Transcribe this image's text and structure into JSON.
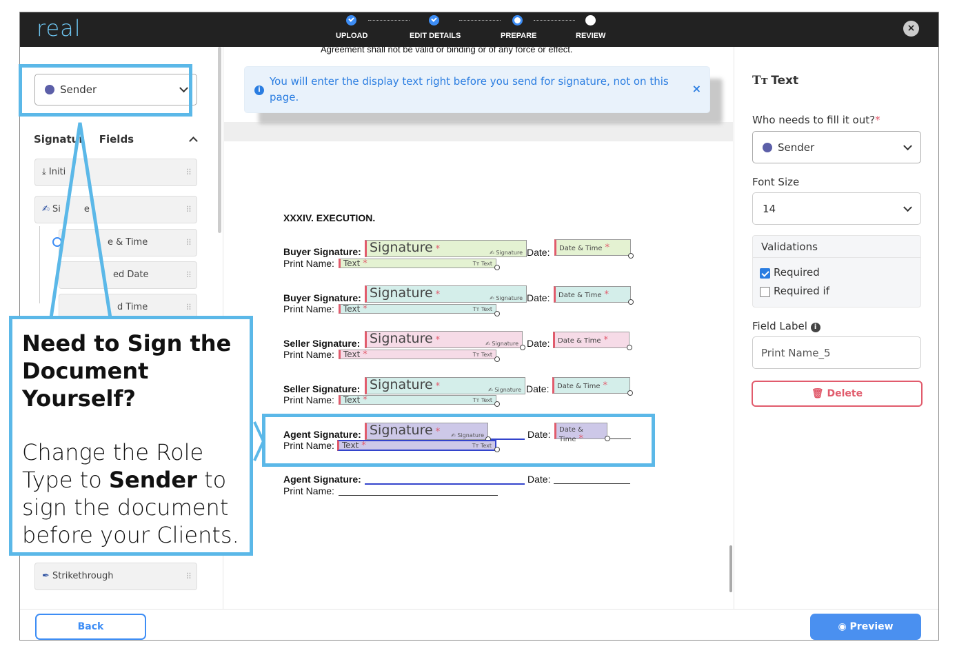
{
  "header": {
    "logo": "real",
    "steps": [
      {
        "label": "UPLOAD",
        "state": "done"
      },
      {
        "label": "EDIT DETAILS",
        "state": "done"
      },
      {
        "label": "PREPARE",
        "state": "current"
      },
      {
        "label": "REVIEW",
        "state": "todo"
      }
    ],
    "close_icon": "x-icon"
  },
  "left_panel": {
    "role_select": {
      "value": "Sender",
      "color": "#5c5fa8"
    },
    "section_title": "Signature Fields",
    "items": [
      {
        "label": "Initials",
        "icon": "download-icon"
      },
      {
        "label": "Signature",
        "icon": "signature-icon"
      },
      {
        "label": "Date & Time",
        "icon": "radio-icon"
      },
      {
        "label": "Signed Date",
        "icon": "radio-icon"
      },
      {
        "label": "Signed Time",
        "icon": "radio-icon"
      }
    ],
    "visible_labels": {
      "initials": "Initi",
      "signature": "Si",
      "signature_tail": "e",
      "date_time": "e & Time",
      "signed_date": "ed Date",
      "signed_time": "d Time",
      "section_head": "Signatur",
      "section_tail": "Fields"
    },
    "bottom_item": {
      "label": "Strikethrough",
      "icon": "pen-icon"
    }
  },
  "document": {
    "top_line": "Agreement shall not be valid or binding or of any force or effect.",
    "banner": {
      "text": "You will enter the display text right before you send for signature, not on this page.",
      "icon": "info-icon",
      "close": "×"
    },
    "section_heading": "XXXIV.  EXECUTION.",
    "labels": {
      "buyer_sig": "Buyer Signature:",
      "seller_sig": "Seller Signature:",
      "agent_sig": "Agent Signature:",
      "print_name": "Print Name:",
      "date": "Date:"
    },
    "field_texts": {
      "signature": "Signature",
      "signature_tag": "Signature",
      "text": "Text",
      "text_tag": "Text",
      "date_time": "Date & Time",
      "required_mark": "*"
    },
    "rows": [
      {
        "role": "buyer",
        "color": "green"
      },
      {
        "role": "buyer",
        "color": "teal"
      },
      {
        "role": "seller",
        "color": "pink"
      },
      {
        "role": "seller",
        "color": "teal"
      },
      {
        "role": "agent",
        "color": "purple"
      }
    ]
  },
  "right_panel": {
    "title": "Text",
    "title_icon": "text-icon",
    "who_label": "Who needs to fill it out?",
    "who_required": "*",
    "who_value": "Sender",
    "font_size_label": "Font Size",
    "font_size_value": "14",
    "validations_label": "Validations",
    "required_label": "Required",
    "required_checked": true,
    "required_if_label": "Required if",
    "required_if_checked": false,
    "field_label_label": "Field Label",
    "field_label_value": "Print Name_5",
    "delete_label": "Delete"
  },
  "footer": {
    "back_label": "Back",
    "preview_label": "Preview"
  },
  "annotation": {
    "title": "Need to Sign the Document Yourself?",
    "body_prefix": "Change the Role Type to ",
    "body_bold": "Sender",
    "body_suffix": " to sign the document before your Clients."
  },
  "colors": {
    "accent": "#3d8df5",
    "highlight": "#5bb8e8",
    "danger": "#e15b6c",
    "sender": "#5c5fa8"
  }
}
